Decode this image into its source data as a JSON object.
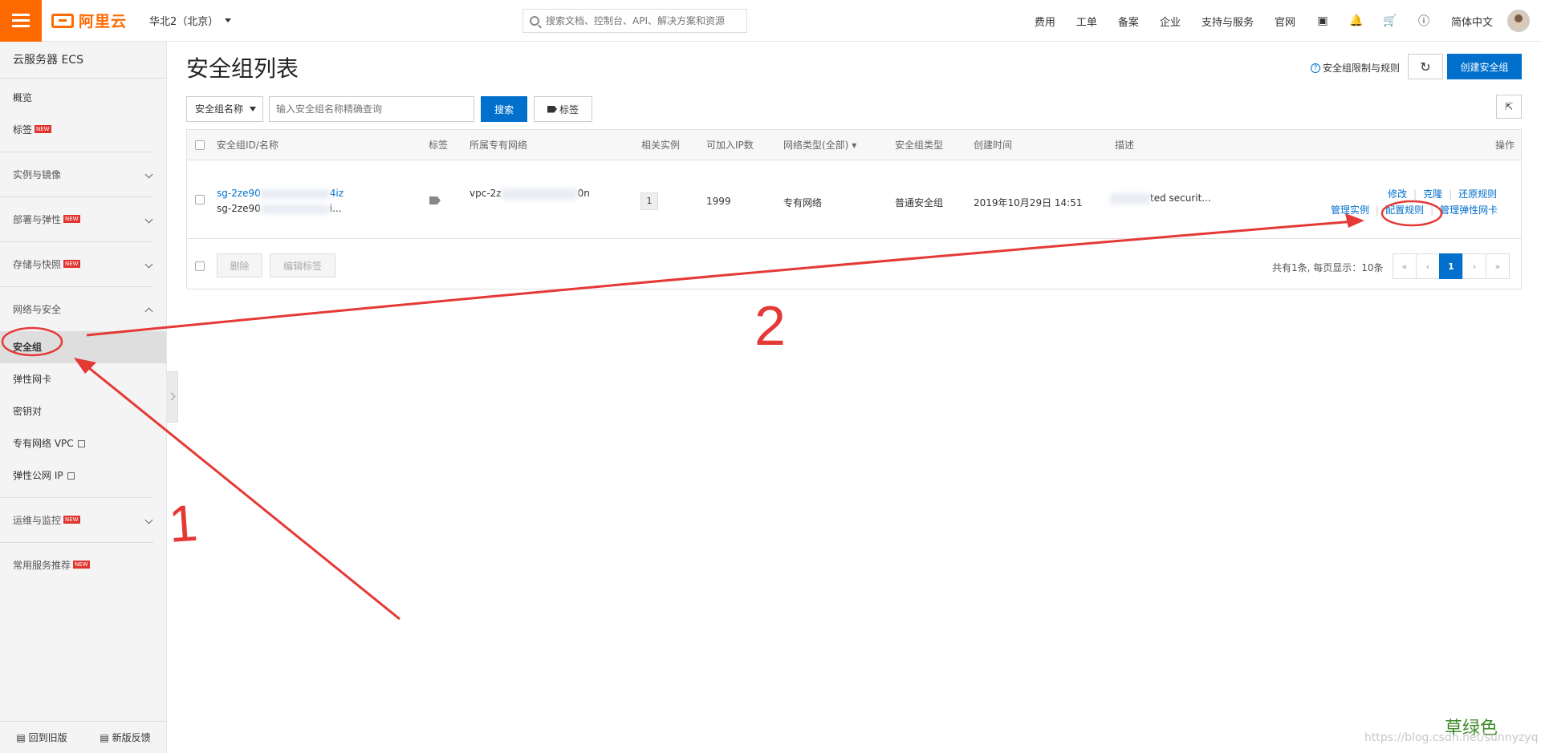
{
  "header": {
    "logo": "阿里云",
    "region": "华北2（北京）",
    "search_placeholder": "搜索文档、控制台、API、解决方案和资源",
    "nav": [
      "费用",
      "工单",
      "备案",
      "企业",
      "支持与服务",
      "官网"
    ],
    "language": "简体中文"
  },
  "sidebar": {
    "title": "云服务器 ECS",
    "top_items": [
      {
        "label": "概览"
      },
      {
        "label": "标签",
        "new": "NEW"
      }
    ],
    "groups": [
      {
        "label": "实例与镜像"
      },
      {
        "label": "部署与弹性",
        "new": "NEW"
      },
      {
        "label": "存储与快照",
        "new": "NEW"
      },
      {
        "label": "网络与安全"
      }
    ],
    "network_items": [
      "安全组",
      "弹性网卡",
      "密钥对",
      "专有网络 VPC",
      "弹性公网 IP"
    ],
    "groups2": [
      {
        "label": "运维与监控",
        "new": "NEW"
      },
      {
        "label": "常用服务推荐",
        "new": "NEW"
      }
    ],
    "footer": [
      "回到旧版",
      "新版反馈"
    ]
  },
  "main": {
    "title": "安全组列表",
    "help_link": "安全组限制与规则",
    "create_button": "创建安全组",
    "filter_select": "安全组名称",
    "filter_placeholder": "输入安全组名称精确查询",
    "search_button": "搜索",
    "tag_button": "标签",
    "columns": [
      "安全组ID/名称",
      "标签",
      "所属专有网络",
      "相关实例",
      "可加入IP数",
      "网络类型(全部)",
      "安全组类型",
      "创建时间",
      "描述",
      "操作"
    ],
    "row": {
      "id_start": "sg-2ze90",
      "id_end": "4iz",
      "name_start": "sg-2ze90",
      "name_end": "i...",
      "vpc_start": "vpc-2z",
      "vpc_end": "0n",
      "instances": "1",
      "ip_count": "1999",
      "network_type": "专有网络",
      "sg_type": "普通安全组",
      "created": "2019年10月29日 14:51",
      "desc": "ted securit...",
      "ops_line1": [
        "修改",
        "克隆",
        "还原规则"
      ],
      "ops_line2": [
        "管理实例",
        "配置规则",
        "管理弹性网卡"
      ]
    },
    "footer_buttons": [
      "删除",
      "编辑标签"
    ],
    "pager_info": "共有1条, 每页显示：10条",
    "pager": [
      "«",
      "‹",
      "1",
      "›",
      "»"
    ]
  },
  "annotations": {
    "mark1": "1",
    "mark2": "2"
  },
  "watermark": {
    "cn": "草绿色",
    "url": "https://blog.csdn.net/sunnyzyq"
  }
}
